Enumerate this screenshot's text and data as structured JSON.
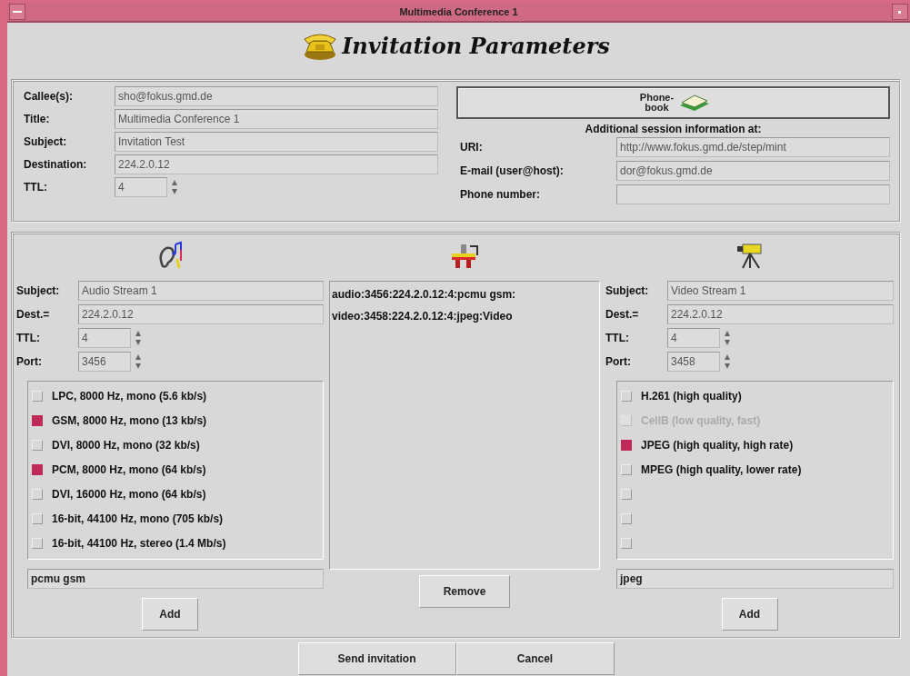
{
  "window": {
    "title": "Multimedia Conference 1"
  },
  "heading": "Invitation Parameters",
  "session": {
    "fields": [
      {
        "kind": "text",
        "label": "Callee(s):",
        "value": "sho@fokus.gmd.de"
      },
      {
        "kind": "text",
        "label": "Title:",
        "value": "Multimedia Conference 1"
      },
      {
        "kind": "text",
        "label": "Subject:",
        "value": "Invitation Test"
      },
      {
        "kind": "text",
        "label": "Destination:",
        "value": "224.2.0.12"
      },
      {
        "kind": "spin",
        "label": "TTL:",
        "value": "4"
      }
    ]
  },
  "phonebook_button": "Phone-book",
  "additional": {
    "heading": "Additional session information at:",
    "fields": [
      {
        "label": "URI:",
        "value": "http://www.fokus.gmd.de/step/mint"
      },
      {
        "label": "E-mail (user@host):",
        "value": "dor@fokus.gmd.de"
      },
      {
        "label": "Phone number:"
      }
    ]
  },
  "streams": [
    {
      "fields": [
        {
          "kind": "text",
          "label": "Subject:",
          "value": "Audio Stream 1"
        },
        {
          "kind": "text",
          "label": "Dest.=",
          "value": "224.2.0.12"
        },
        {
          "kind": "spin",
          "label": "TTL:",
          "value": "4"
        },
        {
          "kind": "spin",
          "label": "Port:",
          "value": "3456"
        }
      ],
      "codecs": [
        {
          "label": "LPC, 8000 Hz, mono (5.6 kb/s)",
          "checked": false,
          "disabled": false
        },
        {
          "label": "GSM, 8000 Hz, mono (13 kb/s)",
          "checked": true,
          "disabled": false
        },
        {
          "label": "DVI, 8000 Hz, mono (32 kb/s)",
          "checked": false,
          "disabled": false
        },
        {
          "label": "PCM, 8000 Hz, mono (64 kb/s)",
          "checked": true,
          "disabled": false
        },
        {
          "label": "DVI, 16000 Hz, mono (64 kb/s)",
          "checked": false,
          "disabled": false
        },
        {
          "label": "16-bit, 44100 Hz, mono (705 kb/s)",
          "checked": false,
          "disabled": false
        },
        {
          "label": "16-bit, 44100 Hz, stereo (1.4 Mb/s)",
          "checked": false,
          "disabled": false
        }
      ],
      "format": "pcmu gsm",
      "add_button": "Add"
    },
    {
      "fields": [
        {
          "kind": "text",
          "label": "Subject:",
          "value": "Video Stream 1"
        },
        {
          "kind": "text",
          "label": "Dest.=",
          "value": "224.2.0.12"
        },
        {
          "kind": "spin",
          "label": "TTL:",
          "value": "4"
        },
        {
          "kind": "spin",
          "label": "Port:",
          "value": "3458"
        }
      ],
      "codecs": [
        {
          "label": "H.261 (high quality)",
          "checked": false,
          "disabled": false
        },
        {
          "label": "CellB (low quality, fast)",
          "checked": false,
          "disabled": true
        },
        {
          "label": "JPEG (high quality, high rate)",
          "checked": true,
          "disabled": false
        },
        {
          "label": "MPEG (high quality, lower rate)",
          "checked": false,
          "disabled": false
        },
        {
          "checked": false,
          "disabled": false
        },
        {
          "checked": false,
          "disabled": false
        },
        {
          "checked": false,
          "disabled": false
        }
      ],
      "format": "jpeg",
      "add_button": "Add"
    }
  ],
  "media_list": {
    "items": [
      "audio:3456:224.2.0.12:4:pcmu gsm:",
      "video:3458:224.2.0.12:4:jpeg:Video"
    ],
    "remove_button": "Remove"
  },
  "buttons": [
    "Send invitation",
    "Cancel"
  ]
}
